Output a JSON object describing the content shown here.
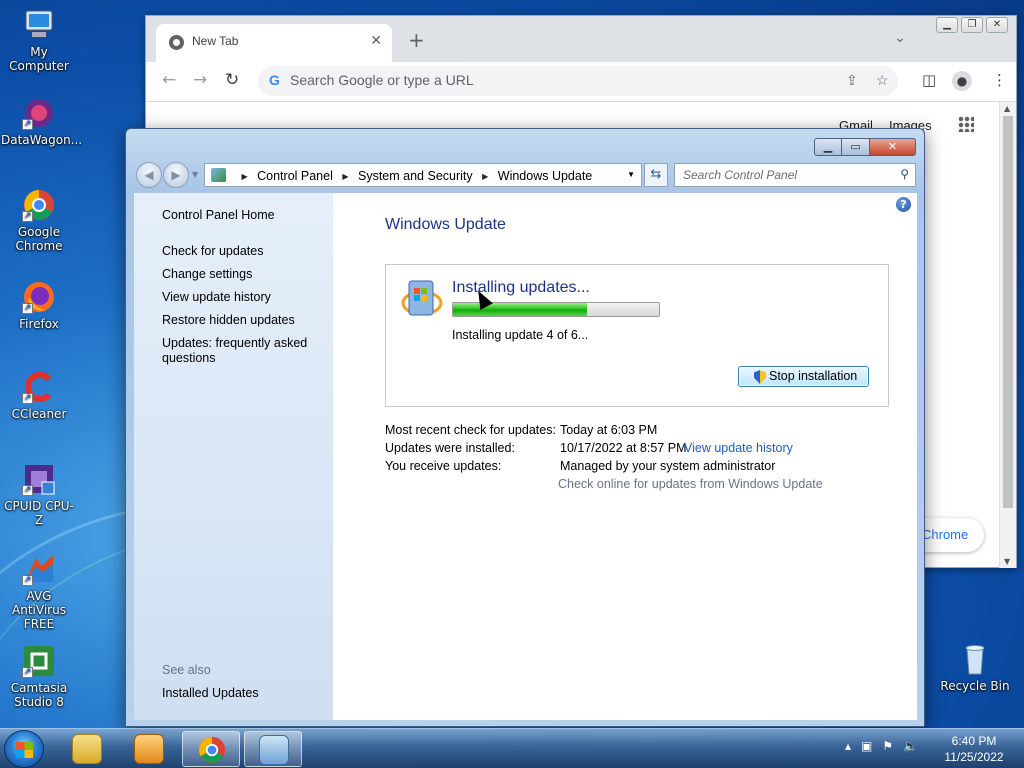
{
  "desktop": {
    "icons": [
      {
        "label": "My Computer"
      },
      {
        "label": "DataWagon..."
      },
      {
        "label": "Google Chrome"
      },
      {
        "label": "Firefox"
      },
      {
        "label": "CCleaner"
      },
      {
        "label": "CPUID CPU-Z"
      },
      {
        "label": "AVG AntiVirus FREE"
      },
      {
        "label": "Camtasia Studio 8"
      },
      {
        "label": "Recycle Bin"
      }
    ]
  },
  "chrome": {
    "tab_title": "New Tab",
    "omnibox_placeholder": "Search Google or type a URL",
    "gmail_link": "Gmail",
    "images_link": "Images",
    "customize_pill": "Chrome"
  },
  "control_panel": {
    "breadcrumbs": [
      "Control Panel",
      "System and Security",
      "Windows Update"
    ],
    "search_placeholder": "Search Control Panel",
    "left_links": {
      "home": "Control Panel Home",
      "check": "Check for updates",
      "change": "Change settings",
      "history": "View update history",
      "restore": "Restore hidden updates",
      "faq": "Updates: frequently asked questions"
    },
    "see_also_heading": "See also",
    "installed_updates": "Installed Updates",
    "page_title": "Windows Update",
    "status_title": "Installing updates...",
    "progress_fraction": 0.65,
    "status_detail": "Installing update 4 of 6...",
    "stop_button": "Stop installation",
    "info": {
      "recent_label": "Most recent check for updates:",
      "recent_value": "Today at 6:03 PM",
      "installed_label": "Updates were installed:",
      "installed_value": "10/17/2022 at 8:57 PM.",
      "installed_link": "View update history",
      "receive_label": "You receive updates:",
      "receive_value": "Managed by your system administrator",
      "online_link": "Check online for updates from Windows Update"
    }
  },
  "taskbar": {
    "time": "6:40 PM",
    "date": "11/25/2022"
  },
  "colors": {
    "title_blue": "#1e3287",
    "link_blue": "#1e5dbd",
    "progress_green": "#29c21c"
  }
}
